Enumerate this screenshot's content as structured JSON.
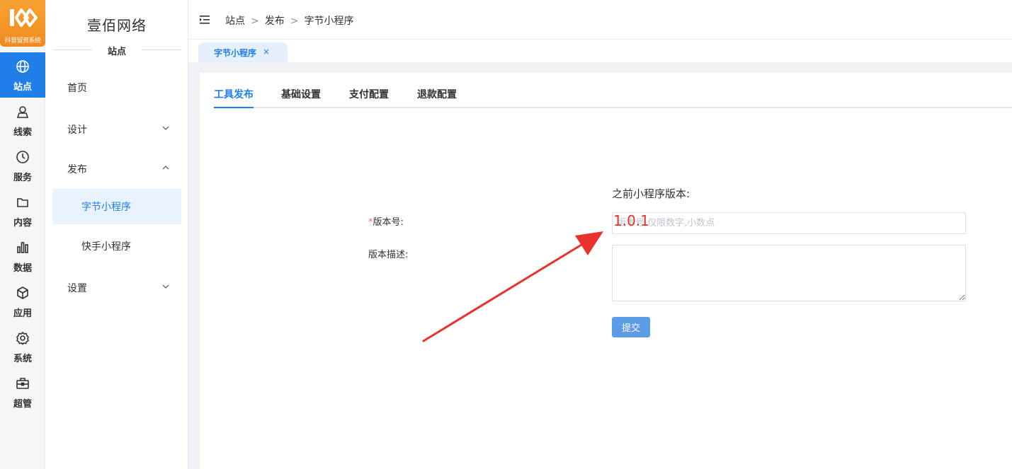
{
  "logo": {
    "text": "抖音留资系统"
  },
  "rail": {
    "items": [
      {
        "label": "站点",
        "icon": "globe-icon",
        "active": true
      },
      {
        "label": "线索",
        "icon": "user-icon"
      },
      {
        "label": "服务",
        "icon": "clock-icon"
      },
      {
        "label": "内容",
        "icon": "folder-icon"
      },
      {
        "label": "数据",
        "icon": "bar-chart-icon"
      },
      {
        "label": "应用",
        "icon": "cube-icon"
      },
      {
        "label": "系统",
        "icon": "gear-icon"
      },
      {
        "label": "超管",
        "icon": "briefcase-icon"
      }
    ]
  },
  "sidebar": {
    "brand": "壹佰网络",
    "section": "站点",
    "items": [
      {
        "label": "首页"
      },
      {
        "label": "设计",
        "icon": "chevron-down-icon"
      },
      {
        "label": "发布",
        "icon": "chevron-up-icon",
        "children": [
          {
            "label": "字节小程序",
            "active": true
          },
          {
            "label": "快手小程序"
          }
        ]
      },
      {
        "label": "设置",
        "icon": "chevron-down-icon"
      }
    ]
  },
  "breadcrumb": {
    "items": [
      "站点",
      "发布",
      "字节小程序"
    ],
    "separator": ">"
  },
  "tagsView": {
    "tag": "字节小程序",
    "close": "×"
  },
  "tabs": [
    {
      "label": "工具发布",
      "active": true
    },
    {
      "label": "基础设置"
    },
    {
      "label": "支付配置"
    },
    {
      "label": "退款配置"
    }
  ],
  "form": {
    "previous_label": "之前小程序版本:",
    "required_mark": "*",
    "version_label": "版本号:",
    "version_placeholder": "版本号,仅限数字,小数点",
    "desc_label": "版本描述:",
    "submit_label": "提交"
  },
  "annotation": {
    "text": "1.0.1",
    "color": "#e8322d"
  },
  "colors": {
    "primary": "#1f7ee8",
    "logo": "#f28a1f",
    "annotation": "#e8322d"
  }
}
